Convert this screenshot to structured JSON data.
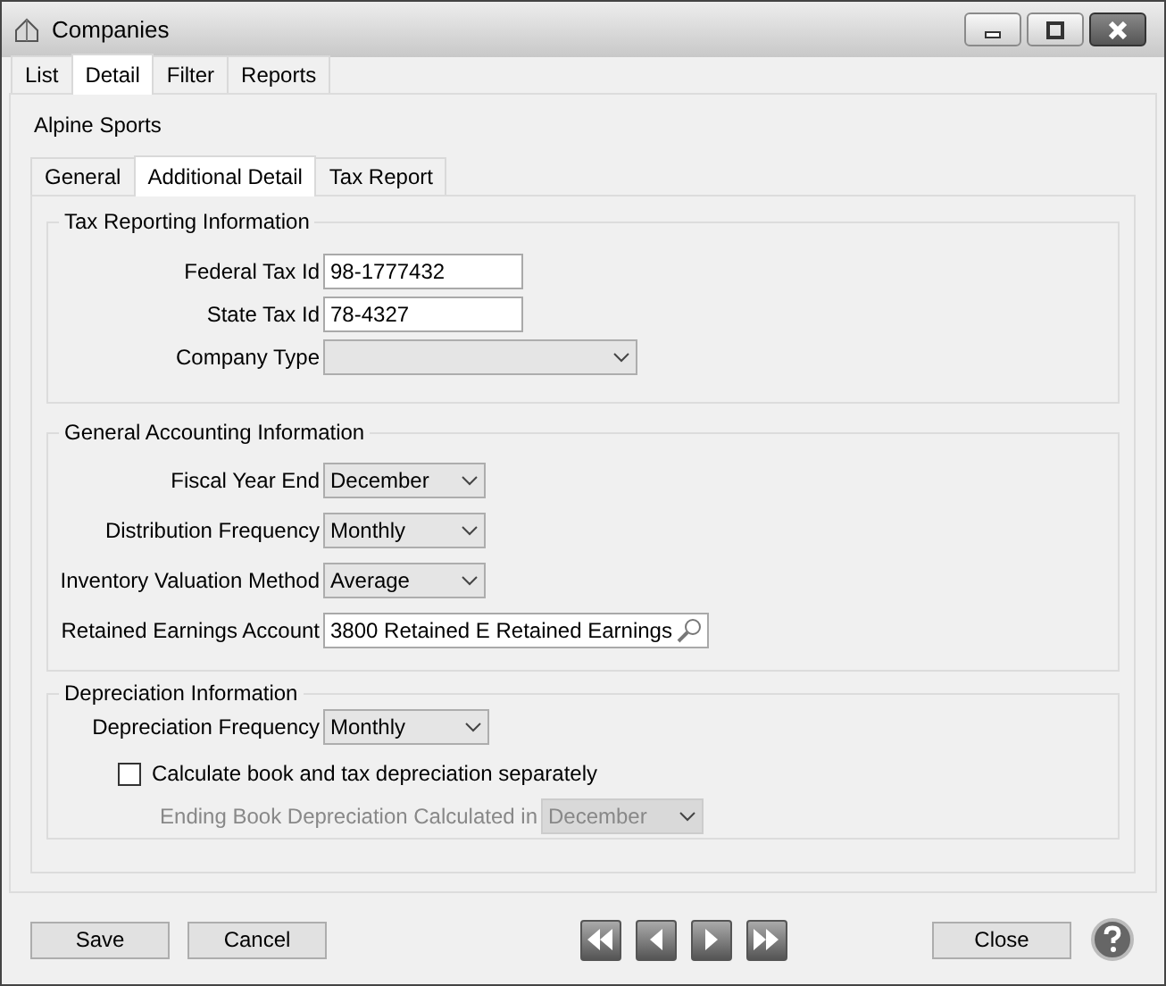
{
  "window": {
    "title": "Companies"
  },
  "tabs": [
    {
      "label": "List",
      "selected": false
    },
    {
      "label": "Detail",
      "selected": true
    },
    {
      "label": "Filter",
      "selected": false
    },
    {
      "label": "Reports",
      "selected": false
    }
  ],
  "company_name": "Alpine Sports",
  "detail_tabs": [
    {
      "label": "General",
      "selected": false
    },
    {
      "label": "Additional Detail",
      "selected": true
    },
    {
      "label": "Tax Report",
      "selected": false
    }
  ],
  "sections": [
    {
      "title": "Tax Reporting Information",
      "rows": [
        {
          "kind": "text",
          "label": "Federal Tax Id",
          "value": "98-1777432"
        },
        {
          "kind": "text",
          "label": "State Tax Id",
          "value": "78-4327"
        },
        {
          "kind": "dropdown",
          "label": "Company Type"
        }
      ]
    },
    {
      "title": "General Accounting Information",
      "rows": [
        {
          "kind": "dropdown",
          "label": "Fiscal Year End",
          "value": "December"
        },
        {
          "kind": "dropdown",
          "label": "Distribution Frequency",
          "value": "Monthly"
        },
        {
          "kind": "dropdown",
          "label": "Inventory Valuation Method",
          "value": "Average"
        },
        {
          "kind": "lookup",
          "label": "Retained Earnings Account",
          "value": "3800 Retained E Retained Earnings"
        }
      ]
    },
    {
      "title": "Depreciation Information",
      "rows": [
        {
          "kind": "dropdown",
          "label": "Depreciation Frequency",
          "value": "Monthly"
        },
        {
          "kind": "checkbox",
          "label": "Calculate book and tax depreciation separately",
          "checked": false,
          "children": [
            {
              "kind": "dropdown",
              "label": "Ending Book Depreciation Calculated in",
              "value": "December",
              "disabled": true
            }
          ]
        }
      ]
    }
  ],
  "buttons": {
    "left": [
      "Save",
      "Cancel"
    ],
    "right": [
      "Close"
    ]
  }
}
